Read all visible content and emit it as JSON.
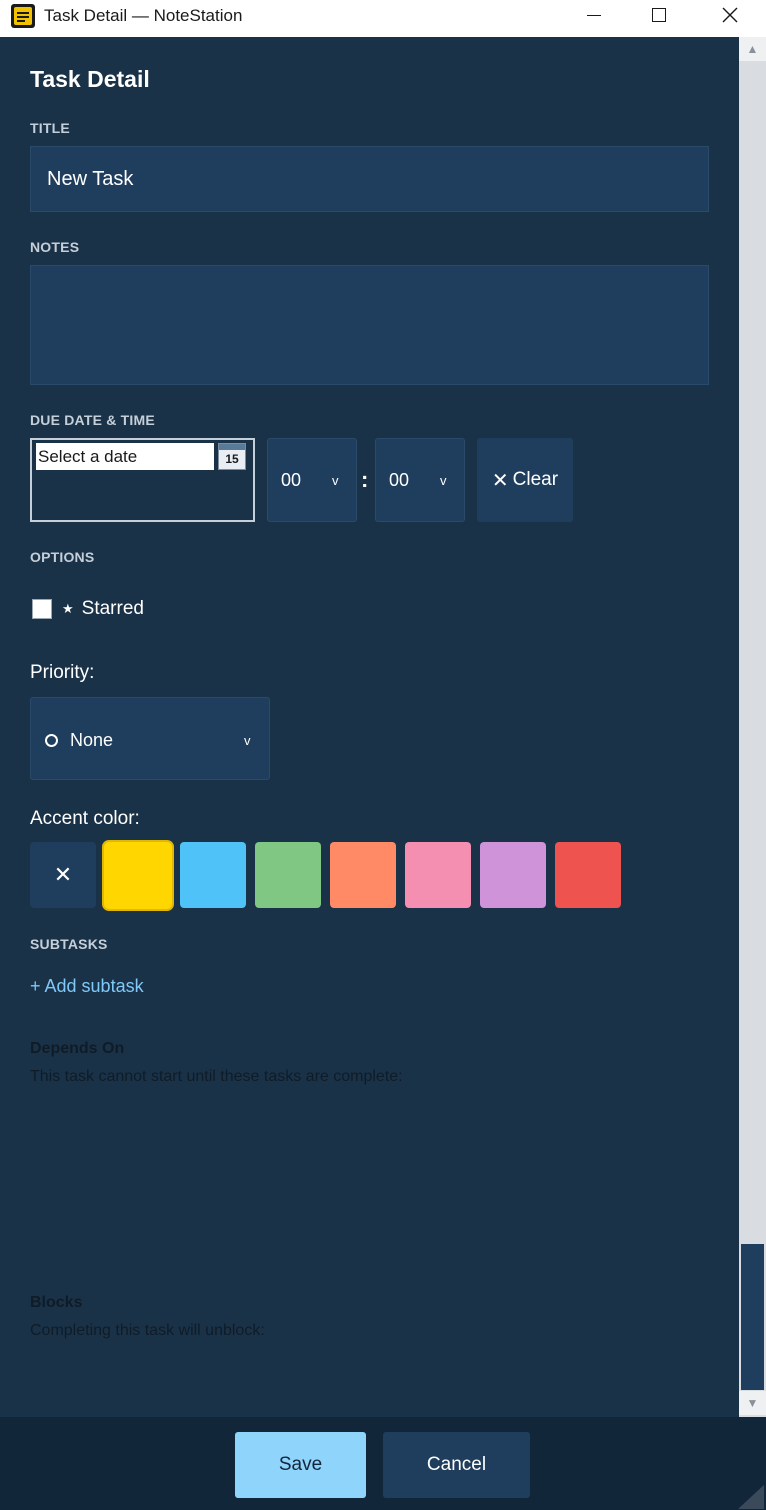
{
  "window": {
    "title": "Task Detail — NoteStation",
    "icons": {
      "app": "notepad-icon",
      "minimize": "minimize-icon",
      "maximize": "maximize-icon",
      "close": "close-icon"
    }
  },
  "form": {
    "heading": "Task Detail",
    "title_label": "TITLE",
    "title_value": "New Task",
    "notes_label": "NOTES",
    "notes_value": "",
    "due_label": "DUE DATE & TIME",
    "date_placeholder": "Select a date",
    "calendar_day": "15",
    "hour_value": "00",
    "minute_value": "00",
    "time_separator": ":",
    "chevron": "v",
    "clear_icon": "✕",
    "clear_label": "Clear",
    "options_label": "OPTIONS",
    "starred_glyph": "★",
    "starred_label": "Starred",
    "starred_checked": false,
    "priority_label": "Priority:",
    "priority_value": "None",
    "accent_label": "Accent color:",
    "accent_none_glyph": "✕",
    "accent_colors": [
      "#ffd600",
      "#4fc3f7",
      "#81c784",
      "#ff8a65",
      "#f48fb1",
      "#ce93d8",
      "#ef5350"
    ],
    "accent_selected": "#ffd600",
    "subtasks_label": "SUBTASKS",
    "add_subtask": "+ Add subtask",
    "depends_heading": "Depends On",
    "depends_text": "This task cannot start until these tasks are complete:",
    "blocks_heading": "Blocks",
    "blocks_text": "Completing this task will unblock:"
  },
  "scrollbar": {
    "up_glyph": "▲",
    "down_glyph": "▼"
  },
  "footer": {
    "save_label": "Save",
    "cancel_label": "Cancel"
  },
  "colors": {
    "background": "#1a3248",
    "field": "#1f3d5c",
    "footer": "#12263a",
    "save": "#8fd4fb",
    "link": "#7fc8f8"
  }
}
